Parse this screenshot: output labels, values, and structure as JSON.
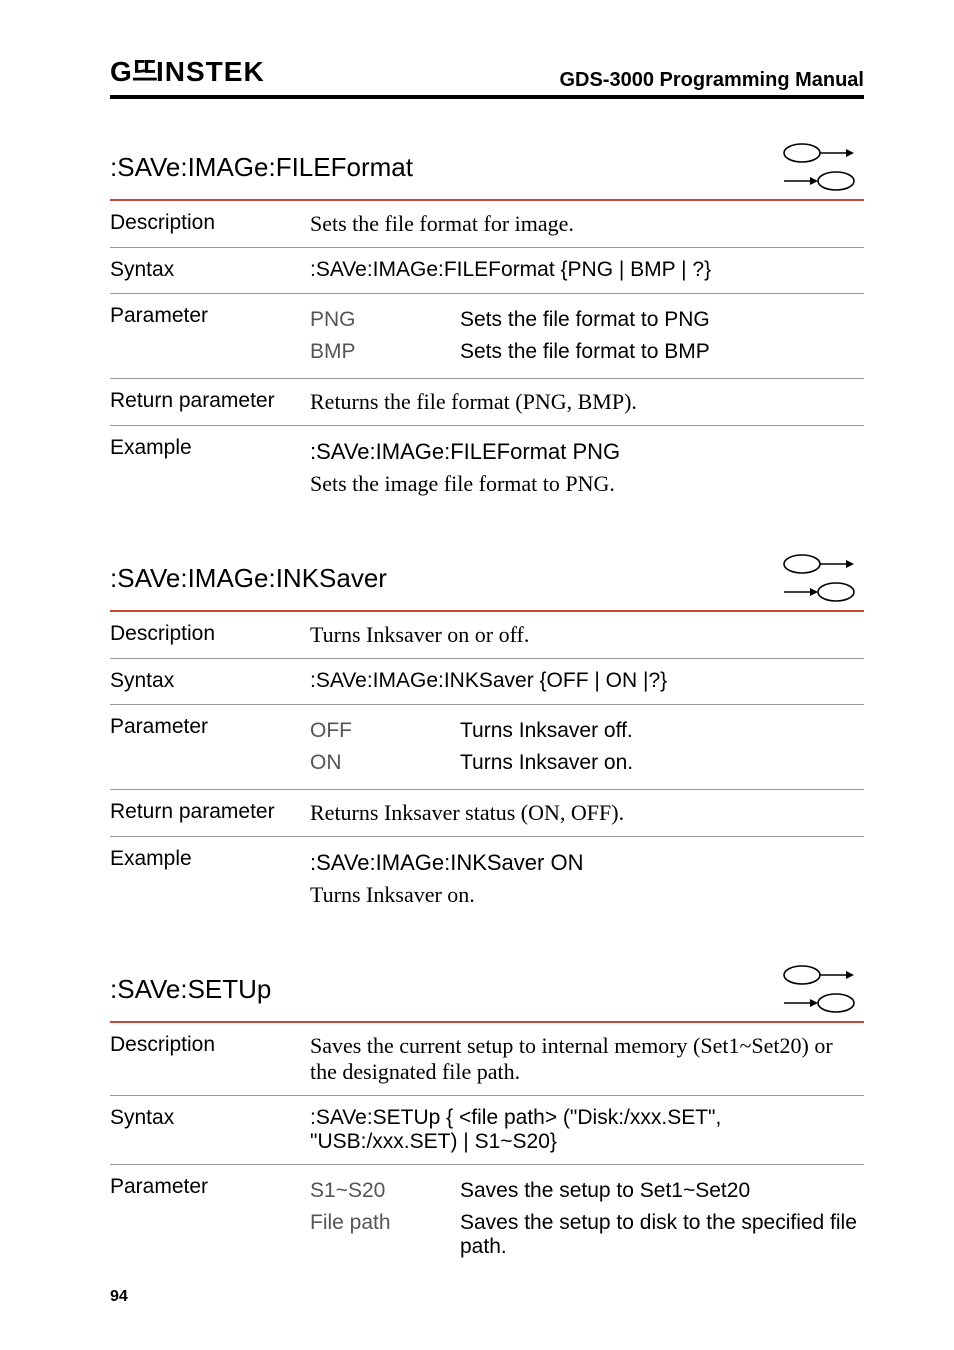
{
  "header": {
    "logo_text": "GWINSTEK",
    "doc_title": "GDS-3000 Programming Manual"
  },
  "sections": [
    {
      "title": ":SAVe:IMAGe:FILEFormat",
      "rows": [
        {
          "label": "Description",
          "content_serif": "Sets the file format for image."
        },
        {
          "label": "Syntax",
          "content_sans": ":SAVe:IMAGe:FILEFormat {PNG | BMP | ?}"
        },
        {
          "label": "Parameter",
          "params": [
            {
              "name": "PNG",
              "desc": "Sets the file format to PNG"
            },
            {
              "name": "BMP",
              "desc": "Sets the file format to BMP"
            }
          ]
        },
        {
          "label": "Return parameter",
          "content_serif": "Returns the file format (PNG, BMP)."
        },
        {
          "label": "Example",
          "no_border": true,
          "lines": [
            {
              "text": ":SAVe:IMAGe:FILEFormat PNG",
              "sans": true
            },
            {
              "text": "Sets the image file format to PNG.",
              "sans": false
            }
          ]
        }
      ]
    },
    {
      "title": ":SAVe:IMAGe:INKSaver",
      "rows": [
        {
          "label": "Description",
          "content_serif": "Turns Inksaver on or off."
        },
        {
          "label": "Syntax",
          "content_sans": ":SAVe:IMAGe:INKSaver {OFF | ON |?}"
        },
        {
          "label": "Parameter",
          "params": [
            {
              "name": "OFF",
              "desc": "Turns Inksaver off."
            },
            {
              "name": "ON",
              "desc": "Turns Inksaver on."
            }
          ]
        },
        {
          "label": "Return parameter",
          "content_serif": "Returns Inksaver status (ON, OFF)."
        },
        {
          "label": "Example",
          "no_border": true,
          "lines": [
            {
              "text": ":SAVe:IMAGe:INKSaver ON",
              "sans": true
            },
            {
              "text": "Turns Inksaver on.",
              "sans": false
            }
          ]
        }
      ]
    },
    {
      "title": ":SAVe:SETUp",
      "rows": [
        {
          "label": "Description",
          "content_serif": "Saves the current setup to internal memory (Set1~Set20) or the designated file path."
        },
        {
          "label": "Syntax",
          "content_sans": ":SAVe:SETUp { <file path> (\"Disk:/xxx.SET\", \"USB:/xxx.SET) | S1~S20}"
        },
        {
          "label": "Parameter",
          "no_border": true,
          "params": [
            {
              "name": "S1~S20",
              "desc": "Saves the setup to Set1~Set20"
            },
            {
              "name": "File path",
              "desc": "Saves the setup to disk to the specified file path."
            }
          ]
        }
      ]
    }
  ],
  "page_number": "94"
}
